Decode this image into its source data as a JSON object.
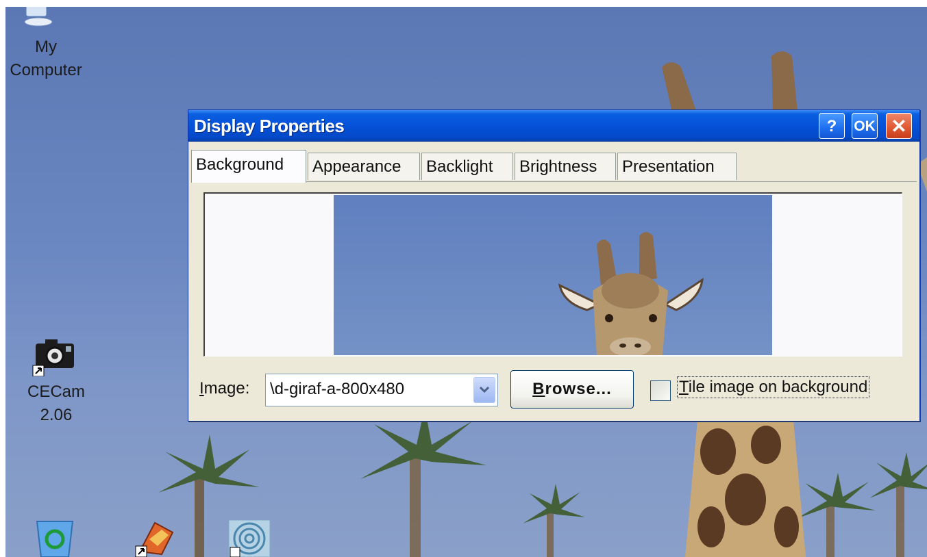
{
  "desktop": {
    "icons": [
      {
        "label_line1": "My",
        "label_line2": "Computer",
        "icon": "my-computer-icon"
      },
      {
        "label_line1": "CECam",
        "label_line2": "2.06",
        "icon": "camera-icon"
      },
      {
        "icon": "recycle-bin-icon"
      },
      {
        "icon": "shortcut-app-icon"
      },
      {
        "icon": "shortcut-spiral-icon"
      }
    ],
    "wallpaper": "giraffe and palm trees"
  },
  "dialog": {
    "title": "Display Properties",
    "help_label": "?",
    "ok_label": "OK",
    "close_label": "✕",
    "tabs": [
      "Background",
      "Appearance",
      "Backlight",
      "Brightness",
      "Presentation"
    ],
    "active_tab": "Background",
    "image_label_accel": "I",
    "image_label_rest": "mage:",
    "image_value": "\\d-giraf-a-800x480",
    "browse_accel": "B",
    "browse_rest": "rowse...",
    "tile_accel": "T",
    "tile_rest": "ile image on background",
    "tile_checked": false
  },
  "colors": {
    "titlebar": "#0551d8",
    "dialog_bg": "#ece9d8",
    "close_button": "#e05b34",
    "desktop_sky": "#6c88c2"
  }
}
